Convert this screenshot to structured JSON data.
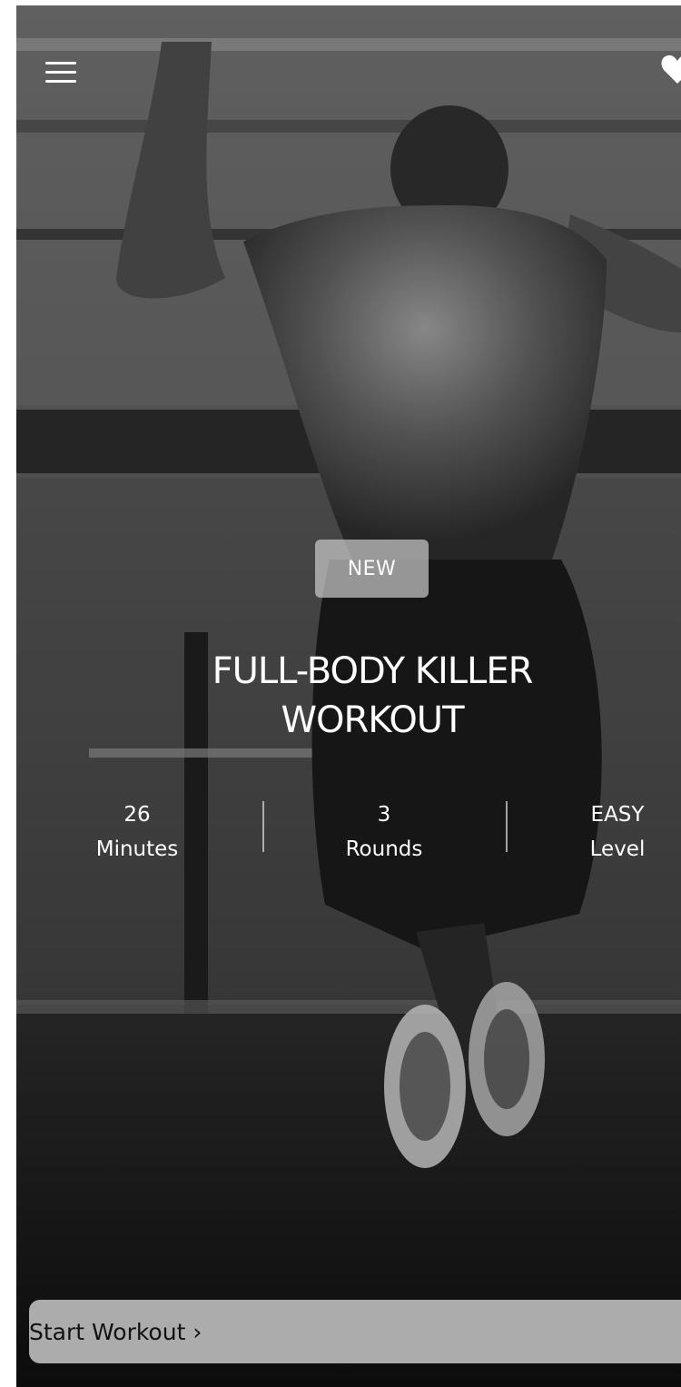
{
  "workout": {
    "badge": "NEW",
    "title_line1": "FULL-BODY KILLER",
    "title_line2": "WORKOUT"
  },
  "stats": [
    {
      "value": "26",
      "label": "Minutes"
    },
    {
      "value": "3",
      "label": "Rounds"
    },
    {
      "value": "EASY",
      "label": "Level"
    }
  ],
  "actions": {
    "start_label": "Start Workout ›"
  },
  "icons": {
    "menu": "hamburger-menu-icon",
    "favorite": "heart-icon"
  },
  "colors": {
    "overlay_button": "#c8c8c8",
    "text_light": "#ffffff",
    "text_dark": "#111111"
  }
}
